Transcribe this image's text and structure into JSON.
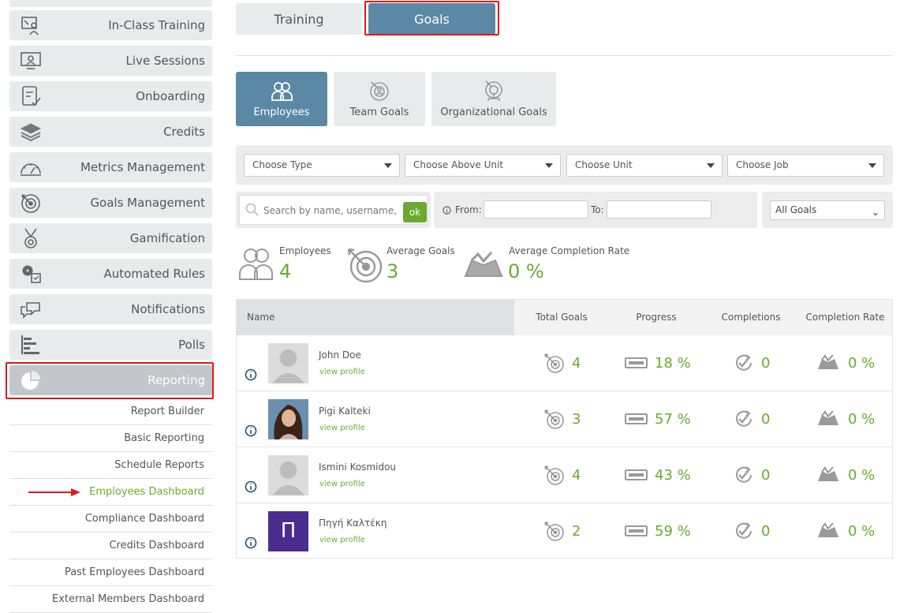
{
  "sidebar": {
    "items": [
      {
        "label": "In-Class Training",
        "icon": "classroom-icon"
      },
      {
        "label": "Live Sessions",
        "icon": "presentation-screen-icon"
      },
      {
        "label": "Onboarding",
        "icon": "checklist-icon"
      },
      {
        "label": "Credits",
        "icon": "stacked-layers-icon"
      },
      {
        "label": "Metrics Management",
        "icon": "gauge-icon"
      },
      {
        "label": "Goals Management",
        "icon": "target-icon"
      },
      {
        "label": "Gamification",
        "icon": "medal-icon"
      },
      {
        "label": "Automated Rules",
        "icon": "gears-icon"
      },
      {
        "label": "Notifications",
        "icon": "chat-bubbles-icon"
      },
      {
        "label": "Polls",
        "icon": "bar-list-icon"
      },
      {
        "label": "Reporting",
        "icon": "pie-chart-icon",
        "active": true
      }
    ],
    "sub_items": [
      {
        "label": "Report Builder"
      },
      {
        "label": "Basic Reporting"
      },
      {
        "label": "Schedule Reports"
      },
      {
        "label": "Employees Dashboard",
        "current": true
      },
      {
        "label": "Compliance Dashboard"
      },
      {
        "label": "Credits Dashboard"
      },
      {
        "label": "Past Employees Dashboard"
      },
      {
        "label": "External Members Dashboard"
      }
    ]
  },
  "top_tabs": {
    "training": "Training",
    "goals": "Goals",
    "active": "goals"
  },
  "sub_tabs": {
    "employees": "Employees",
    "team_goals": "Team Goals",
    "org_goals": "Organizational Goals",
    "active": "employees"
  },
  "filters": {
    "type": "Choose Type",
    "above_unit": "Choose Above Unit",
    "unit": "Choose Unit",
    "job": "Choose Job"
  },
  "search": {
    "placeholder": "Search by name, username, email",
    "ok_label": "ok"
  },
  "dates": {
    "from_label": "From:",
    "to_label": "To:"
  },
  "goals_filter": {
    "selected": "All Goals"
  },
  "stats": {
    "employees_label": "Employees",
    "employees_value": "4",
    "avg_goals_label": "Average Goals",
    "avg_goals_value": "3",
    "avg_completion_label": "Average Completion Rate",
    "avg_completion_value": "0 %"
  },
  "table": {
    "headers": {
      "name": "Name",
      "total_goals": "Total Goals",
      "progress": "Progress",
      "completions": "Completions",
      "completion_rate": "Completion Rate"
    },
    "view_profile": "view profile",
    "rows": [
      {
        "name": "John Doe",
        "total_goals": "4",
        "progress": "18 %",
        "completions": "0",
        "completion_rate": "0 %",
        "avatar": "placeholder"
      },
      {
        "name": "Pigi Kalteki",
        "total_goals": "3",
        "progress": "57 %",
        "completions": "0",
        "completion_rate": "0 %",
        "avatar": "photo"
      },
      {
        "name": "Ismini Kosmidou",
        "total_goals": "4",
        "progress": "43 %",
        "completions": "0",
        "completion_rate": "0 %",
        "avatar": "placeholder"
      },
      {
        "name": "Πηγή Καλτέκη",
        "total_goals": "2",
        "progress": "59 %",
        "completions": "0",
        "completion_rate": "0 %",
        "avatar": "letter",
        "avatar_letter": "Π"
      }
    ]
  },
  "colors": {
    "accent_blue": "#5a88a5",
    "green": "#6aaa2f",
    "highlight_red": "#e01818",
    "avatar_purple": "#4a2d8f"
  }
}
